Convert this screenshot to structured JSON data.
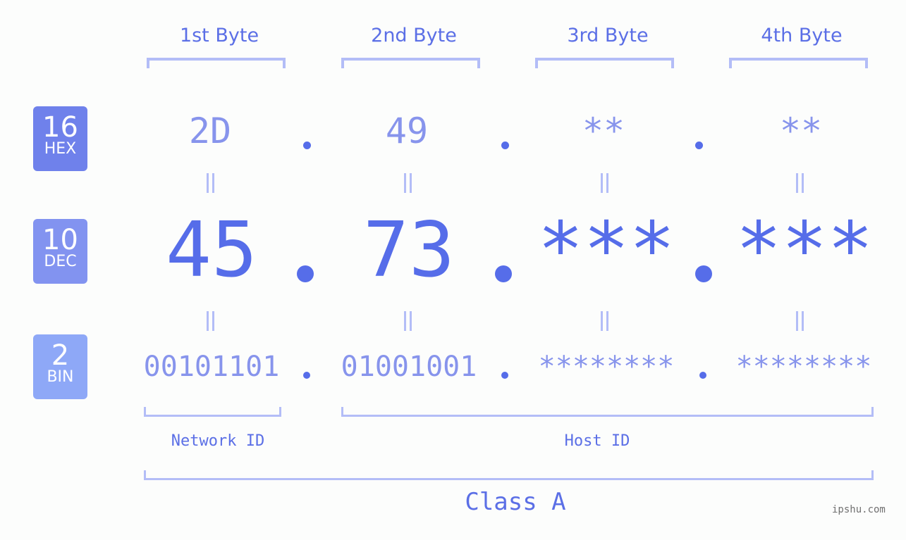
{
  "headers": {
    "bytes": [
      "1st Byte",
      "2nd Byte",
      "3rd Byte",
      "4th Byte"
    ]
  },
  "bases": [
    {
      "number": "16",
      "name": "HEX",
      "color": "#6f81eb"
    },
    {
      "number": "10",
      "name": "DEC",
      "color": "#8293f0"
    },
    {
      "number": "2",
      "name": "BIN",
      "color": "#8ea8f7"
    }
  ],
  "address": {
    "hex": [
      "2D",
      "49",
      "**",
      "**"
    ],
    "dec": [
      "45",
      "73",
      "***",
      "***"
    ],
    "bin": [
      "00101101",
      "01001001",
      "********",
      "********"
    ]
  },
  "labels": {
    "network_id": "Network ID",
    "host_id": "Host ID",
    "class": "Class A"
  },
  "watermark": "ipshu.com",
  "colors": {
    "accent": "#566de9",
    "light_accent": "#8794ec",
    "bracket": "#b3bdf7",
    "background": "#fcfdfc"
  }
}
